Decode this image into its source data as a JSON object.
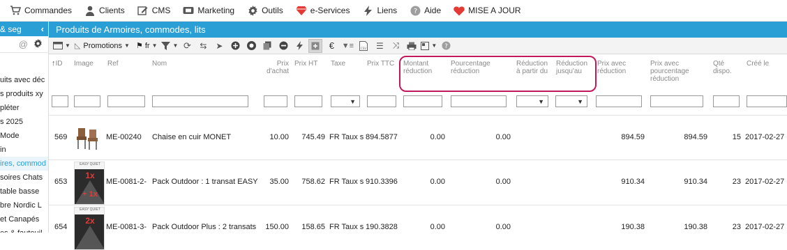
{
  "topmenu": [
    {
      "label": "Commandes",
      "icon": "cart-icon"
    },
    {
      "label": "Clients",
      "icon": "user-icon"
    },
    {
      "label": "CMS",
      "icon": "pencil-icon"
    },
    {
      "label": "Marketing",
      "icon": "ticket-icon"
    },
    {
      "label": "Outils",
      "icon": "gear-icon"
    },
    {
      "label": "e-Services",
      "icon": "diamond-icon"
    },
    {
      "label": "Liens",
      "icon": "bolt-icon"
    },
    {
      "label": "Aide",
      "icon": "help-icon"
    },
    {
      "label": "MISE A JOUR",
      "icon": "heart-icon"
    }
  ],
  "sidebar": {
    "header": "& seg",
    "items": [
      "uits avec déc",
      "s produits xy",
      "pléter",
      "s 2025",
      "Mode",
      "in",
      "ires, commod",
      "soires Chats",
      "table basse",
      "bre Nordic L",
      "et Canapés",
      "es & fauteuil"
    ],
    "active_index": 6
  },
  "title": "Produits de Armoires, commodes, lits",
  "toolbar": {
    "promotions_label": "Promotions",
    "lang_label": "fr"
  },
  "columns": [
    {
      "key": "id",
      "label": "ID",
      "sort": "↑"
    },
    {
      "key": "image",
      "label": "Image"
    },
    {
      "key": "ref",
      "label": "Ref"
    },
    {
      "key": "nom",
      "label": "Nom"
    },
    {
      "key": "prix_achat",
      "label": "Prix d'achat"
    },
    {
      "key": "prix_ht",
      "label": "Prix HT"
    },
    {
      "key": "taxe",
      "label": "Taxe"
    },
    {
      "key": "prix_ttc",
      "label": "Prix TTC"
    },
    {
      "key": "montant_red",
      "label": "Montant réduction"
    },
    {
      "key": "pct_red",
      "label": "Pourcentage réduction"
    },
    {
      "key": "red_from",
      "label": "Réduction à partir du"
    },
    {
      "key": "red_to",
      "label": "Réduction jusqu'au"
    },
    {
      "key": "prix_avec_red",
      "label": "Prix avec réduction"
    },
    {
      "key": "prix_avec_pct",
      "label": "Prix avec pourcentage réduction"
    },
    {
      "key": "qte",
      "label": "Qté dispo."
    },
    {
      "key": "cree",
      "label": "Créé le"
    }
  ],
  "rows": [
    {
      "id": "569",
      "thumb": "chair",
      "ref": "ME-00240",
      "nom": "Chaise en cuir MONET",
      "prix_achat": "10.00",
      "prix_ht": "745.49",
      "taxe": "FR Taux s",
      "prix_ttc": "894.5877",
      "montant_red": "0.00",
      "pct_red": "0.00",
      "prix_avec_red": "894.59",
      "prix_avec_pct": "894.59",
      "qte": "15",
      "cree": "2017-02-27"
    },
    {
      "id": "653",
      "thumb": "easy1",
      "thumb_text": [
        "EASY QUIET",
        "1x",
        "+ 1x"
      ],
      "ref": "ME-0081-2-",
      "nom": "Pack Outdoor : 1 transat EASY",
      "prix_achat": "35.00",
      "prix_ht": "758.62",
      "taxe": "FR Taux s",
      "prix_ttc": "910.3396",
      "montant_red": "0.00",
      "pct_red": "0.00",
      "prix_avec_red": "910.34",
      "prix_avec_pct": "910.34",
      "qte": "23",
      "cree": "2017-02-27"
    },
    {
      "id": "654",
      "thumb": "easy2",
      "thumb_text": [
        "EASY QUIET",
        "2x"
      ],
      "ref": "ME-0081-3-",
      "nom": "Pack Outdoor Plus : 2 transats",
      "prix_achat": "150.00",
      "prix_ht": "158.65",
      "taxe": "FR Taux s",
      "prix_ttc": "190.3828",
      "montant_red": "0.00",
      "pct_red": "0.00",
      "prix_avec_red": "190.38",
      "prix_avec_pct": "190.38",
      "qte": "23",
      "cree": "2017-02-27"
    }
  ],
  "colors": {
    "accent": "#2a9fd6",
    "highlight": "#c2185b"
  }
}
